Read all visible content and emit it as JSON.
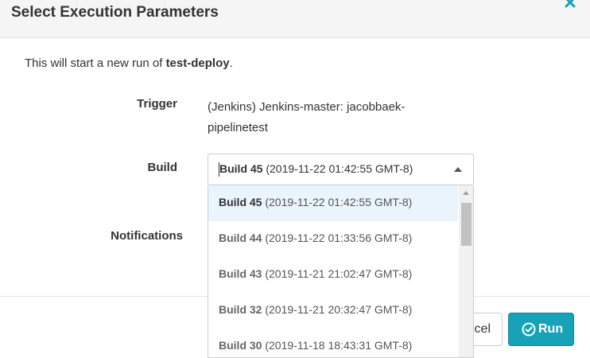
{
  "dialog": {
    "title": "Select Execution Parameters",
    "intro_prefix": "This will start a new run of ",
    "pipeline_name": "test-deploy",
    "intro_suffix": "."
  },
  "fields": {
    "trigger_label": "Trigger",
    "trigger_value": "(Jenkins) Jenkins-master: jacobbaek-pipelinetest",
    "build_label": "Build",
    "notifications_label": "Notifications"
  },
  "build_select": {
    "selected": {
      "name": "Build 45",
      "date": "(2019-11-22 01:42:55 GMT-8)"
    },
    "options": [
      {
        "name": "Build 45",
        "date": "(2019-11-22 01:42:55 GMT-8)"
      },
      {
        "name": "Build 44",
        "date": "(2019-11-22 01:33:56 GMT-8)"
      },
      {
        "name": "Build 43",
        "date": "(2019-11-21 21:02:47 GMT-8)"
      },
      {
        "name": "Build 32",
        "date": "(2019-11-21 20:32:47 GMT-8)"
      },
      {
        "name": "Build 30",
        "date": "(2019-11-18 18:43:31 GMT-8)"
      }
    ]
  },
  "buttons": {
    "cancel_label": "cel",
    "run_label": "Run"
  },
  "colors": {
    "accent": "#17a2b8",
    "selected_option_bg": "#eaf4fc",
    "header_bg": "#f5f5f5"
  },
  "icons": {
    "close": "close-icon",
    "run": "check-circle-icon",
    "select_arrow": "chevron-up-icon"
  }
}
